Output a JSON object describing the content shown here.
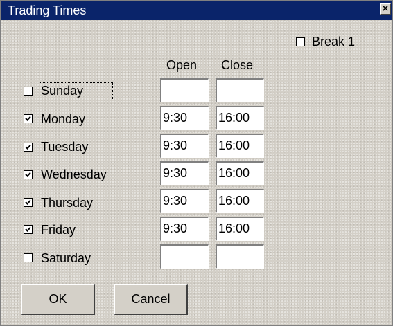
{
  "window": {
    "title": "Trading Times",
    "close_glyph": "×"
  },
  "break": {
    "label": "Break 1",
    "checked": false
  },
  "headers": {
    "open": "Open",
    "close": "Close"
  },
  "days": [
    {
      "label": "Sunday",
      "checked": false,
      "open": "",
      "close": ""
    },
    {
      "label": "Monday",
      "checked": true,
      "open": "9:30",
      "close": "16:00"
    },
    {
      "label": "Tuesday",
      "checked": true,
      "open": "9:30",
      "close": "16:00"
    },
    {
      "label": "Wednesday",
      "checked": true,
      "open": "9:30",
      "close": "16:00"
    },
    {
      "label": "Thursday",
      "checked": true,
      "open": "9:30",
      "close": "16:00"
    },
    {
      "label": "Friday",
      "checked": true,
      "open": "9:30",
      "close": "16:00"
    },
    {
      "label": "Saturday",
      "checked": false,
      "open": "",
      "close": ""
    }
  ],
  "buttons": {
    "ok": "OK",
    "cancel": "Cancel"
  },
  "colors": {
    "titlebar": "#0a246a",
    "face": "#d4d0c8"
  }
}
